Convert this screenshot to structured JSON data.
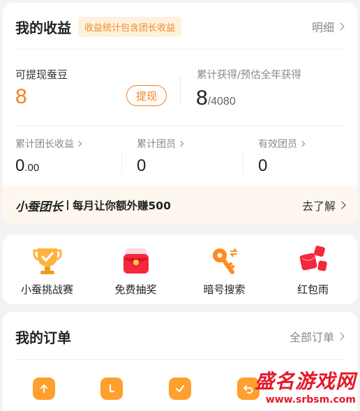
{
  "earnings": {
    "title": "我的收益",
    "badge": "收益统计包含团长收益",
    "detail_link": "明细",
    "withdrawable_label": "可提现蚕豆",
    "withdrawable_value": "8",
    "withdraw_button": "提现",
    "accumulated_label": "累计获得/预估全年获得",
    "accumulated_value": "8",
    "annual_estimate": "/4080",
    "stats": [
      {
        "label": "累计团长收益",
        "value_int": "0",
        "value_dec": ".00"
      },
      {
        "label": "累计团员",
        "value": "0"
      },
      {
        "label": "有效团员",
        "value": "0"
      }
    ]
  },
  "leader_banner": {
    "brand": "小蚕团长",
    "text": "每月让你额外赚500",
    "link": "去了解"
  },
  "features": [
    {
      "label": "小蚕挑战赛",
      "icon": "trophy-icon"
    },
    {
      "label": "免费抽奖",
      "icon": "red-envelope-icon"
    },
    {
      "label": "暗号搜索",
      "icon": "key-icon"
    },
    {
      "label": "红包雨",
      "icon": "red-packets-icon"
    }
  ],
  "orders": {
    "title": "我的订单",
    "all_link": "全部订单",
    "icons": [
      "upload-icon",
      "clock-icon",
      "check-icon",
      "return-icon"
    ]
  },
  "watermark": {
    "title": "盛名游戏网",
    "url": "www.srbsm.com"
  },
  "colors": {
    "accent": "#f58220",
    "badge_bg": "#fff1df",
    "watermark": "#e5182a"
  }
}
